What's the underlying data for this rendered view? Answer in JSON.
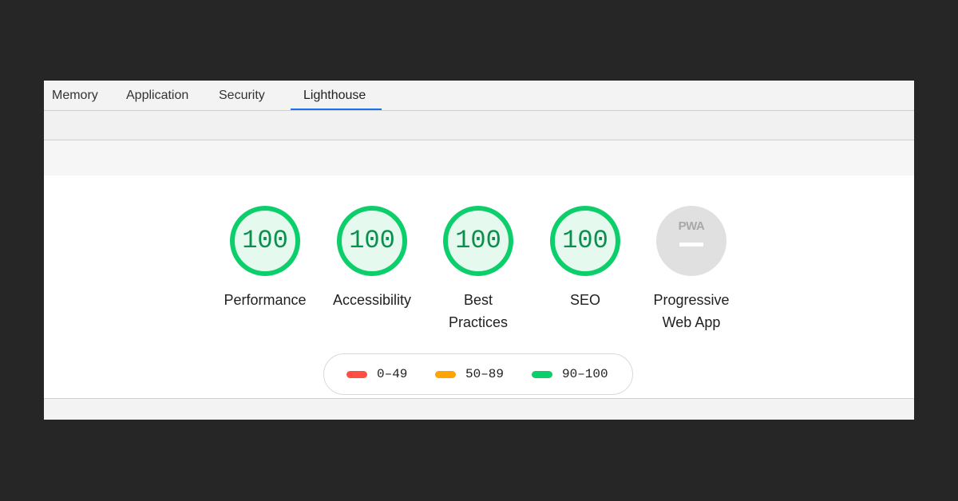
{
  "tabs": [
    {
      "label": "Memory",
      "active": false
    },
    {
      "label": "Application",
      "active": false
    },
    {
      "label": "Security",
      "active": false
    },
    {
      "label": "Lighthouse",
      "active": true
    }
  ],
  "categories": [
    {
      "score": "100",
      "label_lines": [
        "Performance"
      ],
      "status": "pass"
    },
    {
      "score": "100",
      "label_lines": [
        "Accessibility"
      ],
      "status": "pass"
    },
    {
      "score": "100",
      "label_lines": [
        "Best",
        "Practices"
      ],
      "status": "pass"
    },
    {
      "score": "100",
      "label_lines": [
        "SEO"
      ],
      "status": "pass"
    },
    {
      "score": "",
      "badge_text": "PWA",
      "label_lines": [
        "Progressive",
        "Web App"
      ],
      "status": "not-applicable"
    }
  ],
  "legend": [
    {
      "range": "0–49",
      "color": "#ff4e42"
    },
    {
      "range": "50–89",
      "color": "#ffa400"
    },
    {
      "range": "90–100",
      "color": "#0cce6b"
    }
  ],
  "colors": {
    "pass": "#0cce6b",
    "accent": "#1a73e8",
    "na": "#e0e0e0"
  },
  "icons": {
    "pwa": "pwa-logo-icon",
    "na_dash": "dash-icon"
  }
}
